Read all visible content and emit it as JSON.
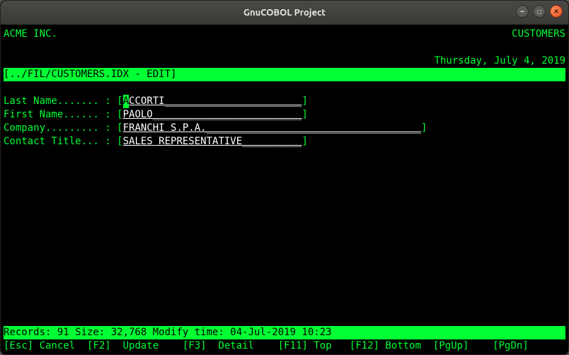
{
  "window": {
    "title": "GnuCOBOL Project"
  },
  "header": {
    "company": "ACME INC.",
    "screen_name": "CUSTOMERS",
    "date_text": "Thursday, July 4, 2019"
  },
  "breadcrumb": "[../FIL/CUSTOMERS.IDX - EDIT]",
  "fields": {
    "last_name": {
      "label": "Last Name....... : ",
      "cursor": "A",
      "rest": "CCORTI",
      "pad_to": 30
    },
    "first_name": {
      "label": "First Name...... : ",
      "value": "PAOLO",
      "pad_to": 30
    },
    "company": {
      "label": "Company......... : ",
      "value": "FRANCHI S.P.A.",
      "pad_to": 50
    },
    "contact": {
      "label": "Contact Title... : ",
      "value": "SALES REPRESENTATIVE",
      "pad_to": 30
    }
  },
  "status_bar": "Records: 91 Size: 32,768 Modify time: 04-Jul-2019 10:23",
  "fn_keys": {
    "esc": "[Esc] Cancel",
    "f2": "[F2]  Update",
    "f3": "[F3]  Detail",
    "f11": "[F11] Top",
    "f12": "[F12] Bottom",
    "pgup": "[PgUp]",
    "pgdn": "[PgDn]"
  }
}
